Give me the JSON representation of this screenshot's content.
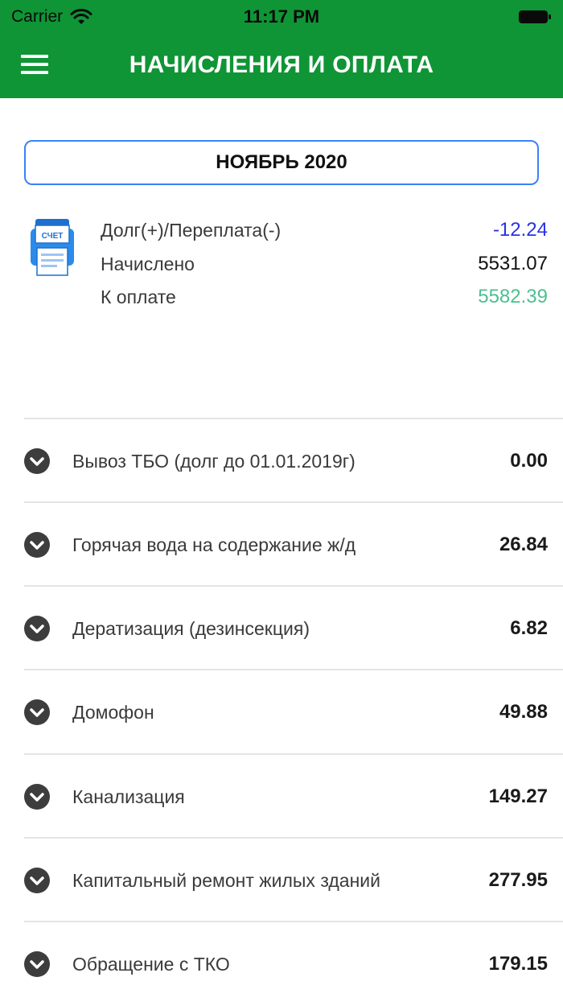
{
  "status_bar": {
    "carrier": "Carrier",
    "time": "11:17 PM"
  },
  "nav": {
    "title": "НАЧИСЛЕНИЯ И ОПЛАТА",
    "menu_icon": "hamburger-menu-icon"
  },
  "colors": {
    "header_green": "#0f9535",
    "debt_blue": "#2a31e6",
    "pay_green": "#4cc08d",
    "button_border": "#3a82f7"
  },
  "month_selector": {
    "label": "НОЯБРЬ 2020"
  },
  "summary": {
    "icon": "invoice-icon",
    "icon_text": "СЧЕТ",
    "debt_label": "Долг(+)/Переплата(-)",
    "debt_value": "-12.24",
    "charged_label": "Начислено",
    "charged_value": "5531.07",
    "to_pay_label": "К оплате",
    "to_pay_value": "5582.39"
  },
  "services": [
    {
      "label": "Вывоз ТБО (долг до 01.01.2019г)",
      "value": "0.00"
    },
    {
      "label": "Горячая вода на содержание ж/д",
      "value": "26.84"
    },
    {
      "label": "Дератизация (дезинсекция)",
      "value": "6.82"
    },
    {
      "label": "Домофон",
      "value": "49.88"
    },
    {
      "label": "Канализация",
      "value": "149.27"
    },
    {
      "label": "Капитальный ремонт жилых зданий",
      "value": "277.95"
    },
    {
      "label": "Обращение с ТКО",
      "value": "179.15"
    }
  ]
}
